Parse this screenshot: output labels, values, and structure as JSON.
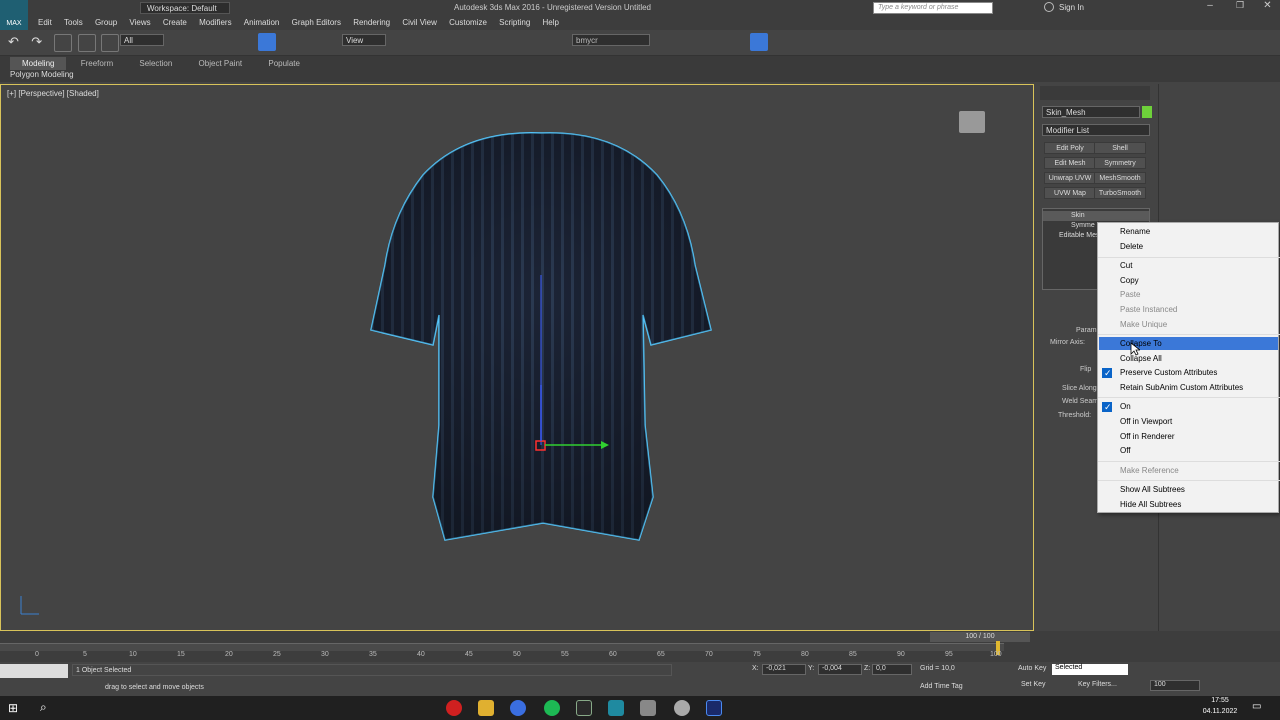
{
  "window": {
    "title": "Autodesk 3ds Max 2016 - Unregistered Version   Untitled",
    "workspace": "Workspace: Default",
    "search_placeholder": "Type a keyword or phrase",
    "sign_in": "Sign In"
  },
  "logo_text": "MAX",
  "menu": [
    "Edit",
    "Tools",
    "Group",
    "Views",
    "Create",
    "Modifiers",
    "Animation",
    "Graph Editors",
    "Rendering",
    "Civil View",
    "Customize",
    "Scripting",
    "Help"
  ],
  "toolbar": {
    "filter": "All",
    "ref_coord": "View",
    "selection_set": "bmycr"
  },
  "ribbon": {
    "tabs": [
      "Modeling",
      "Freeform",
      "Selection",
      "Object Paint",
      "Populate"
    ],
    "sub": "Polygon Modeling"
  },
  "viewport": {
    "label": "[+] [Perspective] [Shaded]"
  },
  "command_panel": {
    "object_name": "Skin_Mesh",
    "modifier_list": "Modifier List",
    "mod_buttons": [
      "Edit Poly",
      "Shell",
      "Edit Mesh",
      "Symmetry",
      "Unwrap UVW",
      "MeshSmooth",
      "UVW Map",
      "TurboSmooth"
    ],
    "stack": [
      "Skin",
      "Symme",
      "Editable Mes"
    ],
    "params_header": "Param",
    "mirror_axis": "Mirror Axis:",
    "flip": "Flip",
    "slice_along": "Slice Along",
    "weld_seam": "Weld Seam",
    "threshold": "Threshold:"
  },
  "context_menu": {
    "items": [
      {
        "label": "Rename",
        "state": "normal"
      },
      {
        "label": "Delete",
        "state": "normal"
      },
      {
        "label": "Cut",
        "state": "normal"
      },
      {
        "label": "Copy",
        "state": "normal"
      },
      {
        "label": "Paste",
        "state": "disabled"
      },
      {
        "label": "Paste Instanced",
        "state": "disabled"
      },
      {
        "label": "Make Unique",
        "state": "disabled"
      },
      {
        "label": "Collapse To",
        "state": "highlighted"
      },
      {
        "label": "Collapse All",
        "state": "normal"
      },
      {
        "label": "Preserve Custom Attributes",
        "state": "checked"
      },
      {
        "label": "Retain SubAnim Custom Attributes",
        "state": "normal"
      },
      {
        "label": "On",
        "state": "checked"
      },
      {
        "label": "Off in Viewport",
        "state": "normal"
      },
      {
        "label": "Off in Renderer",
        "state": "normal"
      },
      {
        "label": "Off",
        "state": "normal"
      },
      {
        "label": "Make Reference",
        "state": "disabled"
      },
      {
        "label": "Show All Subtrees",
        "state": "normal"
      },
      {
        "label": "Hide All Subtrees",
        "state": "normal"
      }
    ]
  },
  "timeline": {
    "frame_display": "100 / 100",
    "ticks": [
      "0",
      "5",
      "10",
      "15",
      "20",
      "25",
      "30",
      "35",
      "40",
      "45",
      "50",
      "55",
      "60",
      "65",
      "70",
      "75",
      "80",
      "85",
      "90",
      "95",
      "100"
    ]
  },
  "status": {
    "selection": "1 Object Selected",
    "prompt": "drag to select and move objects",
    "x_label": "X:",
    "x": "-0,021",
    "y_label": "Y:",
    "y": "-0,004",
    "z_label": "Z:",
    "z": "0,0",
    "grid": "Grid = 10,0",
    "add_time_tag": "Add Time Tag",
    "auto_key": "Auto Key",
    "set_key": "Set Key",
    "key_mode": "Selected",
    "key_filters": "Key Filters...",
    "frame": "100"
  },
  "taskbar": {
    "time": "17:55",
    "date": "04.11.2022"
  },
  "colors": {
    "accent": "#3b78d8",
    "object_swatch": "#6ed13a",
    "viewport_border": "#d8c35a",
    "selection_outline": "#56c8ff"
  }
}
